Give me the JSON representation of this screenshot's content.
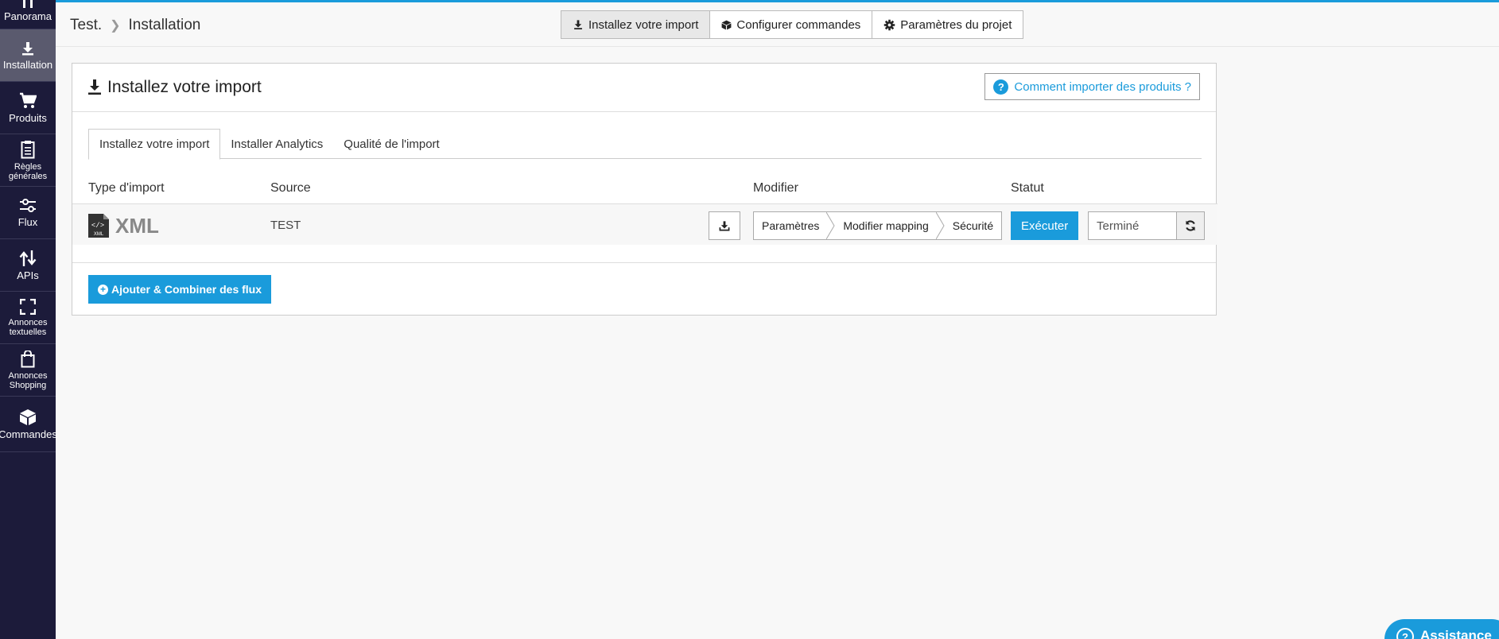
{
  "sidebar": {
    "items": [
      {
        "label": "Panorama",
        "icon": "chart-icon"
      },
      {
        "label": "Installation",
        "icon": "download-icon"
      },
      {
        "label": "Produits",
        "icon": "cart-icon"
      },
      {
        "label": "Règles générales",
        "icon": "clipboard-icon"
      },
      {
        "label": "Flux",
        "icon": "sliders-icon"
      },
      {
        "label": "APIs",
        "icon": "arrows-updown-icon"
      },
      {
        "label": "Annonces textuelles",
        "icon": "expand-icon"
      },
      {
        "label": "Annonces Shopping",
        "icon": "shopping-bag-icon"
      },
      {
        "label": "Commandes",
        "icon": "box-icon"
      }
    ]
  },
  "header": {
    "breadcrumb": [
      "Test.",
      "Installation"
    ],
    "tabs": [
      {
        "label": "Installez votre import",
        "icon": "download-icon"
      },
      {
        "label": "Configurer commandes",
        "icon": "box-icon"
      },
      {
        "label": "Paramètres du projet",
        "icon": "gear-icon"
      }
    ]
  },
  "panel": {
    "title": "Installez votre import",
    "help_label": "Comment importer des produits ?",
    "tabs": [
      "Installez votre import",
      "Installer Analytics",
      "Qualité de l'import"
    ],
    "columns": {
      "type": "Type d'import",
      "source": "Source",
      "modify": "Modifier",
      "status": "Statut"
    },
    "row": {
      "type": "XML",
      "type_badge": "XML",
      "source": "TEST",
      "steps": [
        "Paramètres",
        "Modifier mapping",
        "Sécurité"
      ],
      "execute_label": "Exécuter",
      "status_value": "Terminé"
    },
    "add_label": "Ajouter & Combiner des flux"
  },
  "assist_label": "Assistance",
  "colors": {
    "accent": "#1a9bdb",
    "sidebar": "#1c1b3a",
    "sidebar_active": "#5a5a6e"
  }
}
